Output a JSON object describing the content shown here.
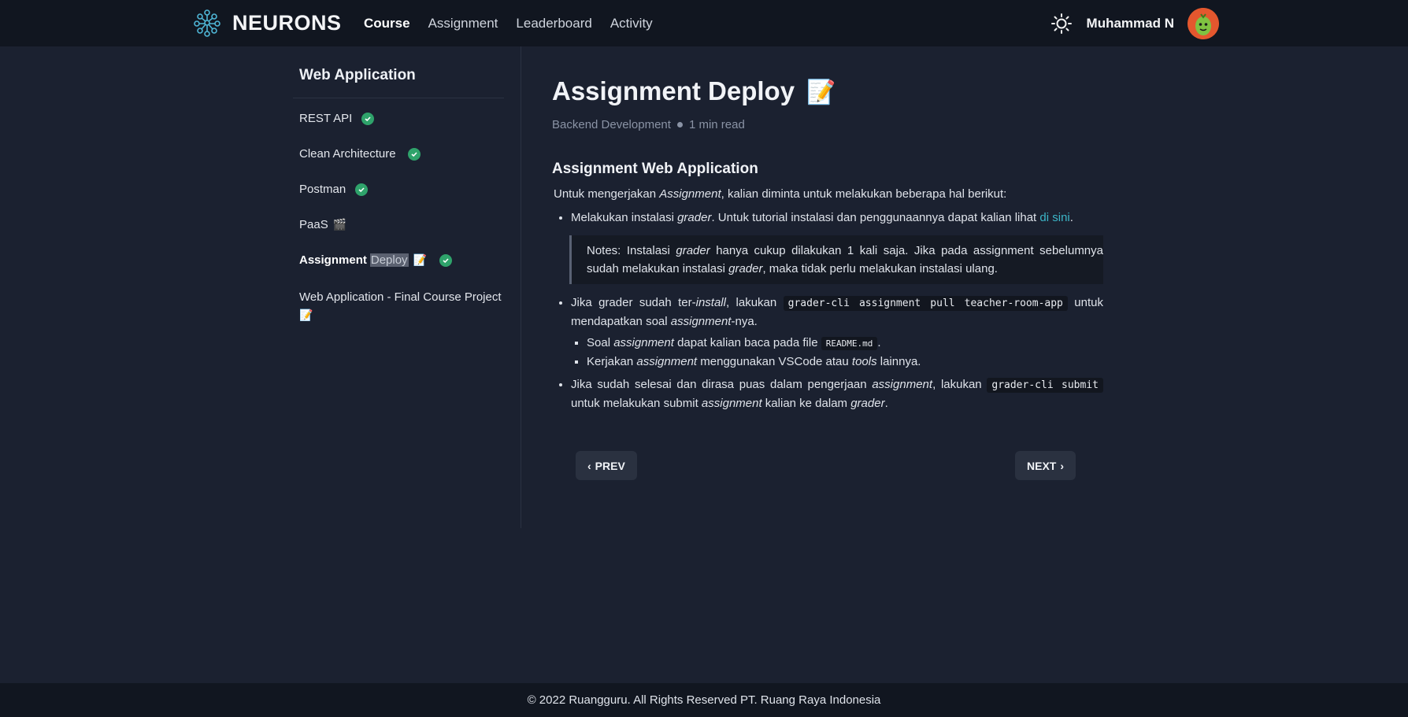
{
  "brand": {
    "name": "NEURONS"
  },
  "nav": {
    "links": [
      "Course",
      "Assignment",
      "Leaderboard",
      "Activity"
    ],
    "active": "Course"
  },
  "user": {
    "name": "Muhammad N"
  },
  "sidebar": {
    "title": "Web Application",
    "items": [
      {
        "label": "REST API",
        "status": "completed"
      },
      {
        "label": "Clean Architecture",
        "status": "completed"
      },
      {
        "label": "Postman",
        "status": "completed"
      },
      {
        "label": "PaaS",
        "emoji": "🎬"
      },
      {
        "label_main": "Assignment",
        "label_highlight": "Deploy",
        "emoji": "📝",
        "status": "completed",
        "active": true
      },
      {
        "label": "Web Application - Final Course Project",
        "emoji": "📝"
      }
    ]
  },
  "article": {
    "title": "Assignment Deploy",
    "title_emoji": "📝",
    "category": "Backend Development",
    "read_time": "1 min read",
    "section_title": "Assignment Web Application",
    "intro_pre": "Untuk mengerjakan ",
    "intro_em": "Assignment",
    "intro_post": ", kalian diminta untuk melakukan beberapa hal berikut:",
    "bullet1_pre": "Melakukan instalasi ",
    "bullet1_em": "grader",
    "bullet1_mid": ". Untuk tutorial instalasi dan penggunaannya dapat kalian lihat ",
    "bullet1_link": "di sini",
    "bullet1_post": ".",
    "note_pre": "Notes: Instalasi ",
    "note_em1": "grader",
    "note_mid": " hanya cukup dilakukan 1 kali saja. Jika pada assignment sebelumnya sudah melakukan instalasi ",
    "note_em2": "grader",
    "note_post": ", maka tidak perlu melakukan instalasi ulang.",
    "bullet2_pre": "Jika grader sudah ter-",
    "bullet2_em1": "install",
    "bullet2_mid": ", lakukan ",
    "bullet2_code": "grader-cli assignment pull teacher-room-app",
    "bullet2_mid2": " untuk mendapatkan soal ",
    "bullet2_em2": "assignment",
    "bullet2_post": "-nya.",
    "sub1_pre": "Soal ",
    "sub1_em": "assignment",
    "sub1_mid": " dapat kalian baca pada file ",
    "sub1_code": "README.md",
    "sub1_post": ".",
    "sub2_pre": "Kerjakan ",
    "sub2_em1": "assignment",
    "sub2_mid": " menggunakan VSCode atau ",
    "sub2_em2": "tools",
    "sub2_post": " lainnya.",
    "bullet3_pre": "Jika sudah selesai dan dirasa puas dalam pengerjaan ",
    "bullet3_em1": "assignment",
    "bullet3_mid": ", lakukan ",
    "bullet3_code": "grader-cli submit",
    "bullet3_mid2": " untuk melakukan submit ",
    "bullet3_em2": "assignment",
    "bullet3_mid3": " kalian ke dalam ",
    "bullet3_em3": "grader",
    "bullet3_post": "."
  },
  "pagination": {
    "prev": "PREV",
    "next": "NEXT"
  },
  "footer": {
    "text": "© 2022 Ruangguru. All Rights Reserved PT. Ruang Raya Indonesia"
  },
  "colors": {
    "background": "#1b2130",
    "navbar": "#111620",
    "accent_link": "#3cb6c8",
    "check": "#2fa36b"
  }
}
